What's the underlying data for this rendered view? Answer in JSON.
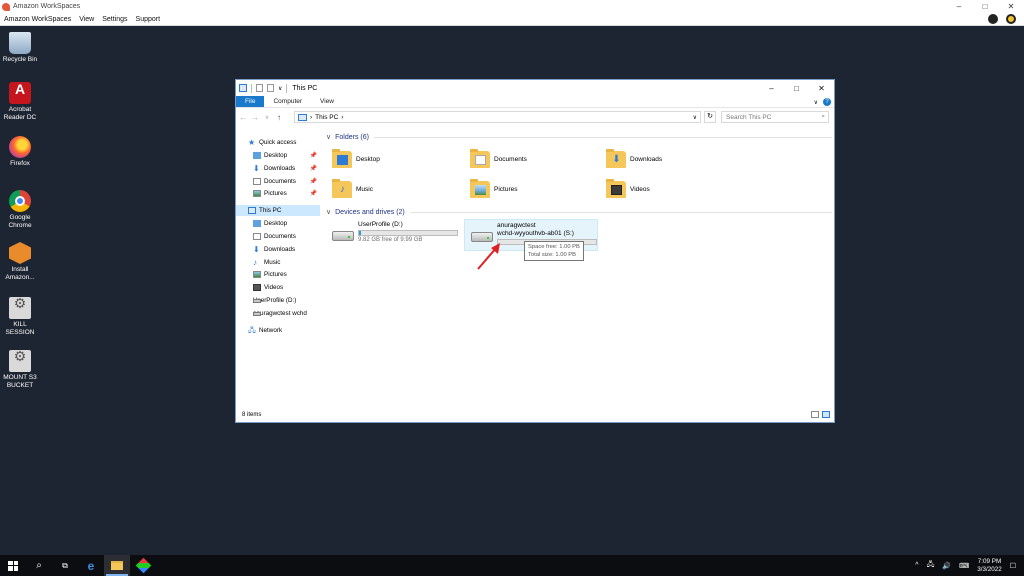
{
  "workspaces": {
    "title": "Amazon WorkSpaces",
    "menu": [
      "Amazon WorkSpaces",
      "View",
      "Settings",
      "Support"
    ],
    "controls": {
      "minimize": "–",
      "maximize": "□",
      "close": "✕"
    }
  },
  "desktop_icons": [
    {
      "label": "Recycle Bin",
      "icon": "recycle-bin-icon"
    },
    {
      "label": "Acrobat Reader DC",
      "icon": "acrobat-icon"
    },
    {
      "label": "Firefox",
      "icon": "firefox-icon"
    },
    {
      "label": "Google Chrome",
      "icon": "chrome-icon"
    },
    {
      "label": "Install Amazon...",
      "icon": "install-icon"
    },
    {
      "label": "KILL SESSION",
      "icon": "gears-icon"
    },
    {
      "label": "MOUNT S3 BUCKET",
      "icon": "gears-icon"
    }
  ],
  "explorer": {
    "title": "This PC",
    "qa_down": "∨",
    "tabs": [
      "File",
      "Computer",
      "View"
    ],
    "ribbon_expand": "∨",
    "help": "?",
    "nav": {
      "back": "←",
      "forward": "→",
      "recent": "∨",
      "up": "↑"
    },
    "address": {
      "sep": "›",
      "location": "This PC",
      "sep2": "›",
      "dropdown": "∨"
    },
    "refresh": "↻",
    "search_placeholder": "Search This PC",
    "search_icon": "⌕",
    "nav_pane": {
      "quick_access": "Quick access",
      "qa_items": [
        "Desktop",
        "Downloads",
        "Documents",
        "Pictures"
      ],
      "this_pc": "This PC",
      "pc_items": [
        "Desktop",
        "Documents",
        "Downloads",
        "Music",
        "Pictures",
        "Videos",
        "UserProfile (D:)",
        "anuragwctest wchd"
      ],
      "network": "Network"
    },
    "folders_header": "Folders (6)",
    "folders": [
      "Desktop",
      "Documents",
      "Downloads",
      "Music",
      "Pictures",
      "Videos"
    ],
    "drives_header": "Devices and drives (2)",
    "drives": [
      {
        "name": "UserProfile (D:)",
        "free": "9.82 GB free of 9.99 GB",
        "used_fraction": 0.02
      },
      {
        "name_line1": "anuragwctest",
        "name_line2": "wchd-wyyouthvb-ab01 (S:)",
        "used_fraction": 0.0
      }
    ],
    "tooltip": {
      "line1": "Space free: 1.00 PB",
      "line2": "Total size: 1.00 PB"
    },
    "status": "8 items"
  },
  "taskbar": {
    "clock_time": "7:09 PM",
    "clock_date": "3/3/2022",
    "tray_up": "^",
    "notifications": "☐"
  },
  "colors": {
    "accent": "#1979ca",
    "selection": "#cce8ff",
    "desktop": "#1e2532",
    "arrow": "#e02020"
  }
}
